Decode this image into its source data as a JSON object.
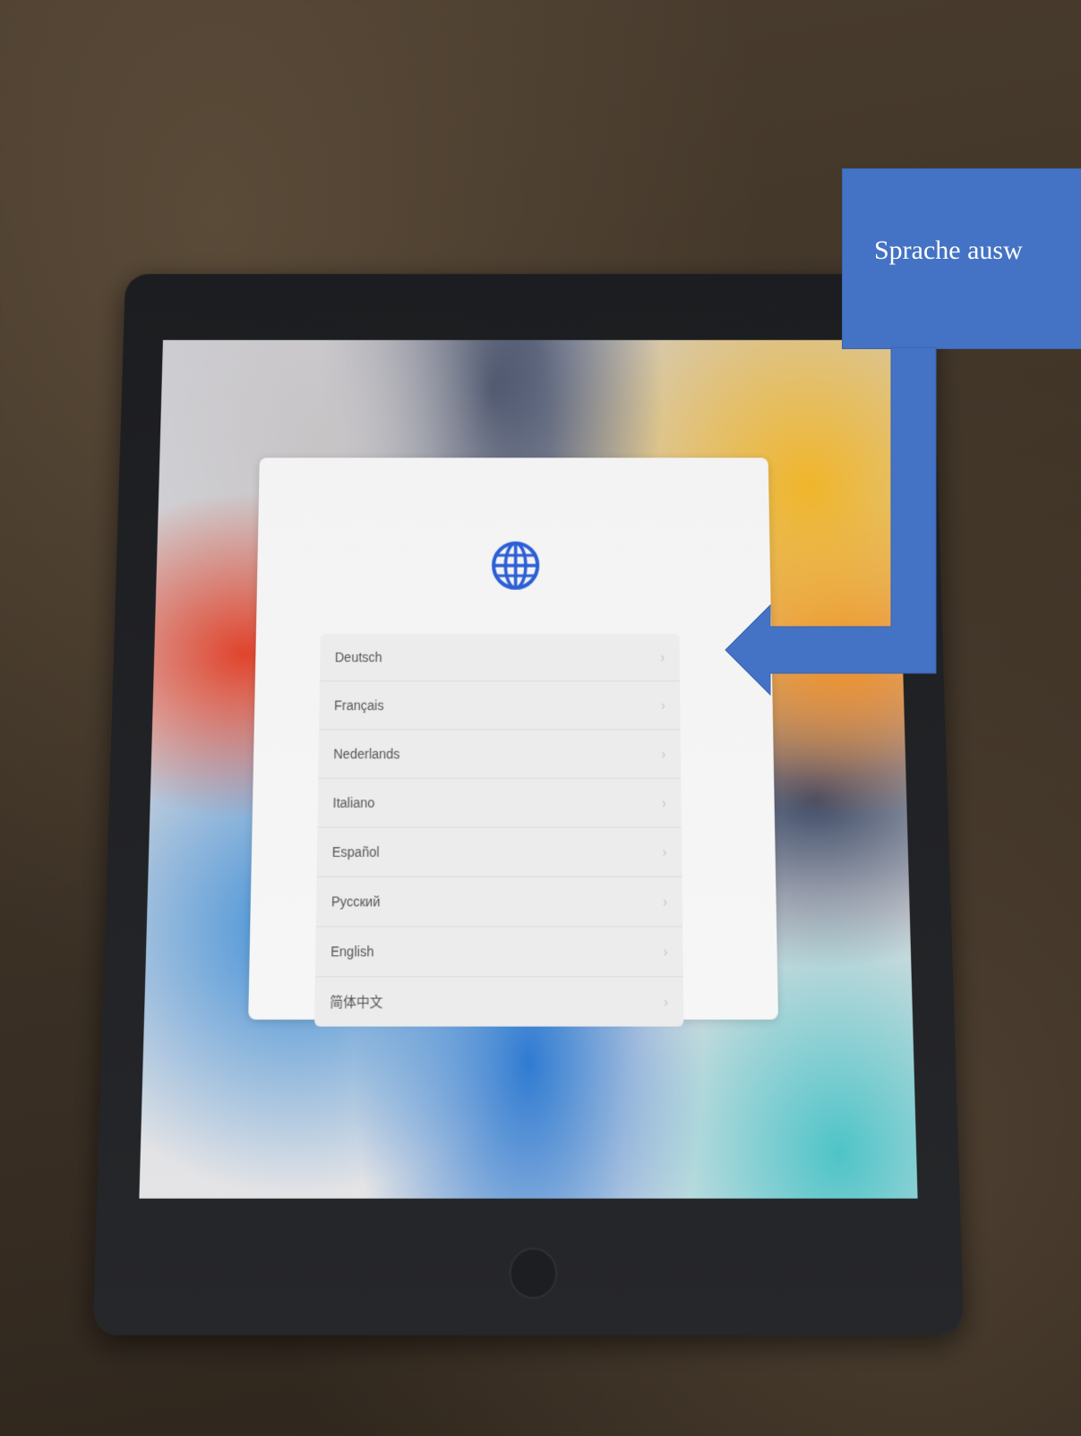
{
  "callout": {
    "text": "Sprache ausw",
    "color": "#4472c4"
  },
  "screen": {
    "icon": "globe-icon",
    "icon_color": "#2c5fd6"
  },
  "languages": [
    {
      "label": "Deutsch"
    },
    {
      "label": "Français"
    },
    {
      "label": "Nederlands"
    },
    {
      "label": "Italiano"
    },
    {
      "label": "Español"
    },
    {
      "label": "Русский"
    },
    {
      "label": "English"
    },
    {
      "label": "简体中文"
    }
  ],
  "chevron_icon": "chevron-right-icon"
}
